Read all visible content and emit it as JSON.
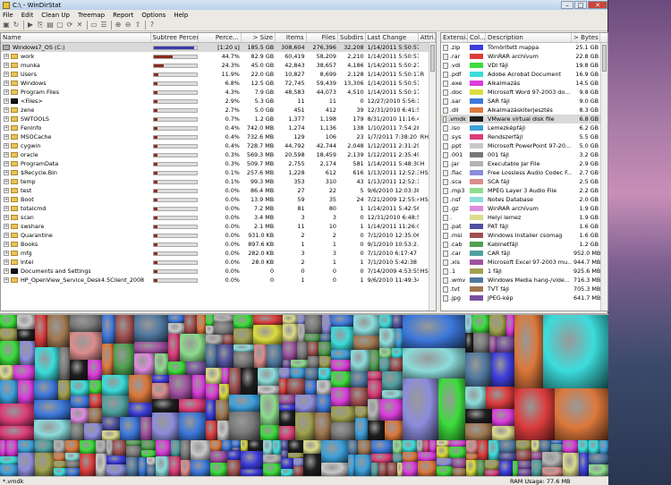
{
  "window": {
    "title": "C:\\ - WinDirStat"
  },
  "titlebar_buttons": {
    "min": "–",
    "max": "□",
    "close": "✕"
  },
  "menu": [
    "File",
    "Edit",
    "Clean Up",
    "Treemap",
    "Report",
    "Options",
    "Help"
  ],
  "tree": {
    "columns": [
      "Name",
      "Subtree Percent...",
      "Perce...",
      "> Size",
      "Items",
      "Files",
      "Subdirs",
      "Last Change",
      "Attri..."
    ],
    "rows": [
      {
        "name": "Windows7_OS (C:)",
        "pct": "[1:20 s]",
        "size": "185.5 GB",
        "items": "308,604",
        "files": "276,396",
        "subdirs": "32,208",
        "date": "1/14/2011 5:50:57 ...",
        "attr": "",
        "bar": 0.95,
        "root": true
      },
      {
        "name": "work",
        "pct": "44.7%",
        "size": "82.9 GB",
        "items": "60,419",
        "files": "58,209",
        "subdirs": "2,210",
        "date": "1/14/2011 5:50:57 ...",
        "attr": "",
        "bar": 0.447
      },
      {
        "name": "munka",
        "pct": "24.3%",
        "size": "45.0 GB",
        "items": "42,843",
        "files": "38,657",
        "subdirs": "4,186",
        "date": "1/14/2011 5:50:27 ...",
        "attr": "",
        "bar": 0.243
      },
      {
        "name": "Users",
        "pct": "11.9%",
        "size": "22.0 GB",
        "items": "10,827",
        "files": "8,699",
        "subdirs": "2,128",
        "date": "1/14/2011 5:50:17 ...",
        "attr": "R",
        "bar": 0.119
      },
      {
        "name": "Windows",
        "pct": "6.8%",
        "size": "12.5 GB",
        "items": "72,745",
        "files": "59,439",
        "subdirs": "13,306",
        "date": "1/14/2011 5:50:57 ...",
        "attr": "",
        "bar": 0.068
      },
      {
        "name": "Program Files",
        "pct": "4.3%",
        "size": "7.9 GB",
        "items": "48,583",
        "files": "44,073",
        "subdirs": "4,510",
        "date": "1/14/2011 5:50:17 ...",
        "attr": "",
        "bar": 0.043
      },
      {
        "name": "<Files>",
        "pct": "2.9%",
        "size": "5.3 GB",
        "items": "11",
        "files": "11",
        "subdirs": "0",
        "date": "12/27/2010 5:56:1...",
        "attr": "",
        "bar": 0.029,
        "icon": "blk"
      },
      {
        "name": "zene",
        "pct": "2.7%",
        "size": "5.0 GB",
        "items": "451",
        "files": "412",
        "subdirs": "39",
        "date": "12/31/2010 6:41:5...",
        "attr": "",
        "bar": 0.027
      },
      {
        "name": "SWTOOLS",
        "pct": "0.7%",
        "size": "1.2 GB",
        "items": "1,377",
        "files": "1,198",
        "subdirs": "179",
        "date": "8/31/2010 11:16:4...",
        "attr": "",
        "bar": 0.007
      },
      {
        "name": "FenInfo",
        "pct": "0.4%",
        "size": "742.0 MB",
        "items": "1,274",
        "files": "1,136",
        "subdirs": "138",
        "date": "1/10/2011 7:54:28 ...",
        "attr": "",
        "bar": 0.004
      },
      {
        "name": "MSOCache",
        "pct": "0.4%",
        "size": "732.6 MB",
        "items": "129",
        "files": "106",
        "subdirs": "23",
        "date": "1/7/2011 7:38:20 A...",
        "attr": "RH",
        "bar": 0.004
      },
      {
        "name": "cygwin",
        "pct": "0.4%",
        "size": "728.7 MB",
        "items": "44,792",
        "files": "42,744",
        "subdirs": "2,048",
        "date": "1/12/2011 2:31:29 ...",
        "attr": "",
        "bar": 0.004
      },
      {
        "name": "oracle",
        "pct": "0.3%",
        "size": "569.3 MB",
        "items": "20,598",
        "files": "18,459",
        "subdirs": "2,139",
        "date": "1/12/2011 2:35:49 ...",
        "attr": "",
        "bar": 0.003
      },
      {
        "name": "ProgramData",
        "pct": "0.3%",
        "size": "509.7 MB",
        "items": "2,755",
        "files": "2,174",
        "subdirs": "581",
        "date": "1/14/2011 5:48:30 ...",
        "attr": "H",
        "bar": 0.003
      },
      {
        "name": "$Recycle.Bin",
        "pct": "0.1%",
        "size": "257.6 MB",
        "items": "1,228",
        "files": "612",
        "subdirs": "616",
        "date": "1/13/2011 12:52:3...",
        "attr": "HS",
        "bar": 0.001
      },
      {
        "name": "temp",
        "pct": "0.1%",
        "size": "99.3 MB",
        "items": "353",
        "files": "310",
        "subdirs": "43",
        "date": "1/13/2011 12:52:1...",
        "attr": "",
        "bar": 0.001
      },
      {
        "name": "test",
        "pct": "0.0%",
        "size": "86.4 MB",
        "items": "27",
        "files": "22",
        "subdirs": "5",
        "date": "9/6/2010 12:03:38 ...",
        "attr": "",
        "bar": 0
      },
      {
        "name": "Boot",
        "pct": "0.0%",
        "size": "13.9 MB",
        "items": "59",
        "files": "35",
        "subdirs": "24",
        "date": "7/21/2009 12:55:4...",
        "attr": "HS",
        "bar": 0
      },
      {
        "name": "totalcmd",
        "pct": "0.0%",
        "size": "7.2 MB",
        "items": "81",
        "files": "80",
        "subdirs": "1",
        "date": "1/14/2011 5:42:56 ...",
        "attr": "",
        "bar": 0
      },
      {
        "name": "scan",
        "pct": "0.0%",
        "size": "3.4 MB",
        "items": "3",
        "files": "3",
        "subdirs": "0",
        "date": "12/31/2010 6:48:5...",
        "attr": "",
        "bar": 0
      },
      {
        "name": "swshare",
        "pct": "0.0%",
        "size": "2.1 MB",
        "items": "11",
        "files": "10",
        "subdirs": "1",
        "date": "1/14/2011 11:26:07 ...",
        "attr": "",
        "bar": 0
      },
      {
        "name": "Quarantine",
        "pct": "0.0%",
        "size": "931.0 KB",
        "items": "2",
        "files": "2",
        "subdirs": "0",
        "date": "7/1/2010 12:35:06 ...",
        "attr": "",
        "bar": 0
      },
      {
        "name": "Books",
        "pct": "0.0%",
        "size": "897.6 KB",
        "items": "1",
        "files": "1",
        "subdirs": "0",
        "date": "9/1/2010 10:53:2...",
        "attr": "",
        "bar": 0
      },
      {
        "name": "mfg",
        "pct": "0.0%",
        "size": "282.0 KB",
        "items": "3",
        "files": "3",
        "subdirs": "0",
        "date": "7/1/2010 6:17:47 A...",
        "attr": "",
        "bar": 0
      },
      {
        "name": "Intel",
        "pct": "0.0%",
        "size": "28.0 KB",
        "items": "2",
        "files": "1",
        "subdirs": "1",
        "date": "7/1/2010 5:42:38 A...",
        "attr": "",
        "bar": 0
      },
      {
        "name": "Documents and Settings",
        "pct": "0.0%",
        "size": "0",
        "items": "0",
        "files": "0",
        "subdirs": "0",
        "date": "7/14/2009 4:53:55 ...",
        "attr": "HS",
        "bar": 0,
        "icon": "blk"
      },
      {
        "name": "HP_OpenView_Service_Desk4.5Client_2008",
        "pct": "0.0%",
        "size": "0",
        "items": "1",
        "files": "0",
        "subdirs": "1",
        "date": "9/6/2010 11:49:34 ...",
        "attr": "",
        "bar": 0
      }
    ]
  },
  "ext": {
    "columns": [
      "Extensi...",
      "Col...",
      "Description",
      "> Bytes"
    ],
    "rows": [
      {
        "ext": ".zip",
        "color": "#3c3cdc",
        "desc": "Tömörített mappa",
        "bytes": "25.1 GB"
      },
      {
        "ext": ".rar",
        "color": "#dc3c3c",
        "desc": "WinRAR archívum",
        "bytes": "22.8 GB"
      },
      {
        "ext": ".vdi",
        "color": "#3cdc3c",
        "desc": "VDI fájl",
        "bytes": "19.8 GB"
      },
      {
        "ext": ".pdf",
        "color": "#3cdcdc",
        "desc": "Adobe Acrobat Document",
        "bytes": "16.9 GB"
      },
      {
        "ext": ".exe",
        "color": "#dc3cdc",
        "desc": "Alkalmazás",
        "bytes": "14.5 GB"
      },
      {
        "ext": ".doc",
        "color": "#dcdc3c",
        "desc": "Microsoft Word 97-2003 do...",
        "bytes": "9.8 GB"
      },
      {
        "ext": ".sar",
        "color": "#3c78dc",
        "desc": "SAR fájl",
        "bytes": "9.0 GB"
      },
      {
        "ext": ".dll",
        "color": "#dc783c",
        "desc": "Alkalmazáskiterjesztés",
        "bytes": "8.3 GB"
      },
      {
        "ext": ".vmdk",
        "color": "#1e1e1e",
        "desc": "VMware virtual disk file",
        "bytes": "6.8 GB",
        "sel": true
      },
      {
        "ext": ".iso",
        "color": "#3ca0dc",
        "desc": "Lemezképfájl",
        "bytes": "6.2 GB"
      },
      {
        "ext": ".sys",
        "color": "#dc3c78",
        "desc": "Rendszerfájl",
        "bytes": "5.5 GB"
      },
      {
        "ext": ".ppt",
        "color": "#c8c8c8",
        "desc": "Microsoft PowerPoint 97-20...",
        "bytes": "5.0 GB"
      },
      {
        "ext": ".001",
        "color": "#787878",
        "desc": "001 fájl",
        "bytes": "3.2 GB"
      },
      {
        "ext": ".jar",
        "color": "#b4b4b4",
        "desc": "Executable Jar File",
        "bytes": "2.9 GB"
      },
      {
        "ext": ".flac",
        "color": "#8c8cdc",
        "desc": "Free Lossless Audio Codec F...",
        "bytes": "2.7 GB"
      },
      {
        "ext": ".sca",
        "color": "#dc8c8c",
        "desc": "SCA fájl",
        "bytes": "2.5 GB"
      },
      {
        "ext": ".mp3",
        "color": "#8cdc8c",
        "desc": "MPEG Layer 3 Audio File",
        "bytes": "2.2 GB"
      },
      {
        "ext": ".nsf",
        "color": "#8cdcdc",
        "desc": "Notes Database",
        "bytes": "2.0 GB"
      },
      {
        "ext": ".gz",
        "color": "#dc8cdc",
        "desc": "WinRAR archívum",
        "bytes": "1.9 GB"
      },
      {
        "ext": ".",
        "color": "#dcdc8c",
        "desc": "Helyi lemez",
        "bytes": "1.9 GB"
      },
      {
        "ext": ".pat",
        "color": "#5050a0",
        "desc": "PAT fájl",
        "bytes": "1.6 GB"
      },
      {
        "ext": ".msi",
        "color": "#a05050",
        "desc": "Windows Installer csomag",
        "bytes": "1.6 GB"
      },
      {
        "ext": ".cab",
        "color": "#50a050",
        "desc": "Kabinetfájl",
        "bytes": "1.2 GB"
      },
      {
        "ext": ".car",
        "color": "#50a0a0",
        "desc": "CAR fájl",
        "bytes": "952.0 MB"
      },
      {
        "ext": ".xls",
        "color": "#a050a0",
        "desc": "Microsoft Excel 97-2003 mu...",
        "bytes": "944.7 MB"
      },
      {
        "ext": ".1",
        "color": "#a0a050",
        "desc": "1 fájl",
        "bytes": "925.6 MB"
      },
      {
        "ext": ".wmv",
        "color": "#5078a0",
        "desc": "Windows Media hang-/vide...",
        "bytes": "716.3 MB"
      },
      {
        "ext": ".tvt",
        "color": "#a07850",
        "desc": "TVT fájl",
        "bytes": "705.3 MB"
      },
      {
        "ext": ".jpg",
        "color": "#7850a0",
        "desc": "JPEG-kép",
        "bytes": "641.7 MB"
      }
    ]
  },
  "status": {
    "path": "*.vmdk",
    "ram_label": "RAM Usage:",
    "ram_value": "77.6 MB"
  },
  "colors": {
    "selection": "#d9d9d9",
    "bar_fill": "#8b2b20",
    "root_bar": "#3c3ca8"
  }
}
